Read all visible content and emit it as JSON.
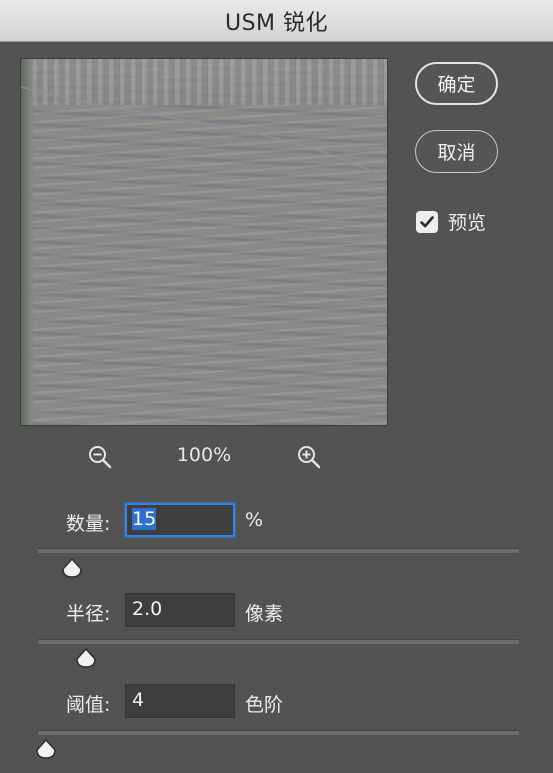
{
  "window": {
    "title": "USM 锐化"
  },
  "buttons": {
    "ok_label": "确定",
    "cancel_label": "取消"
  },
  "preview_toggle": {
    "label": "预览",
    "checked": true
  },
  "zoom": {
    "level": "100%"
  },
  "fields": {
    "amount": {
      "label": "数量:",
      "value": "15",
      "unit": "%",
      "slider_fraction": 0.07
    },
    "radius": {
      "label": "半径:",
      "value": "2.0",
      "unit": "像素",
      "slider_fraction": 0.1
    },
    "threshold": {
      "label": "阈值:",
      "value": "4",
      "unit": "色阶",
      "slider_fraction": 0.016
    }
  },
  "icons": {
    "zoom_out": "zoom-out-icon",
    "zoom_in": "zoom-in-icon",
    "checkmark": "checkmark-icon"
  },
  "colors": {
    "dialog_bg": "#535353",
    "focus_ring": "#3e82d4",
    "selection": "#2e6fd1"
  }
}
